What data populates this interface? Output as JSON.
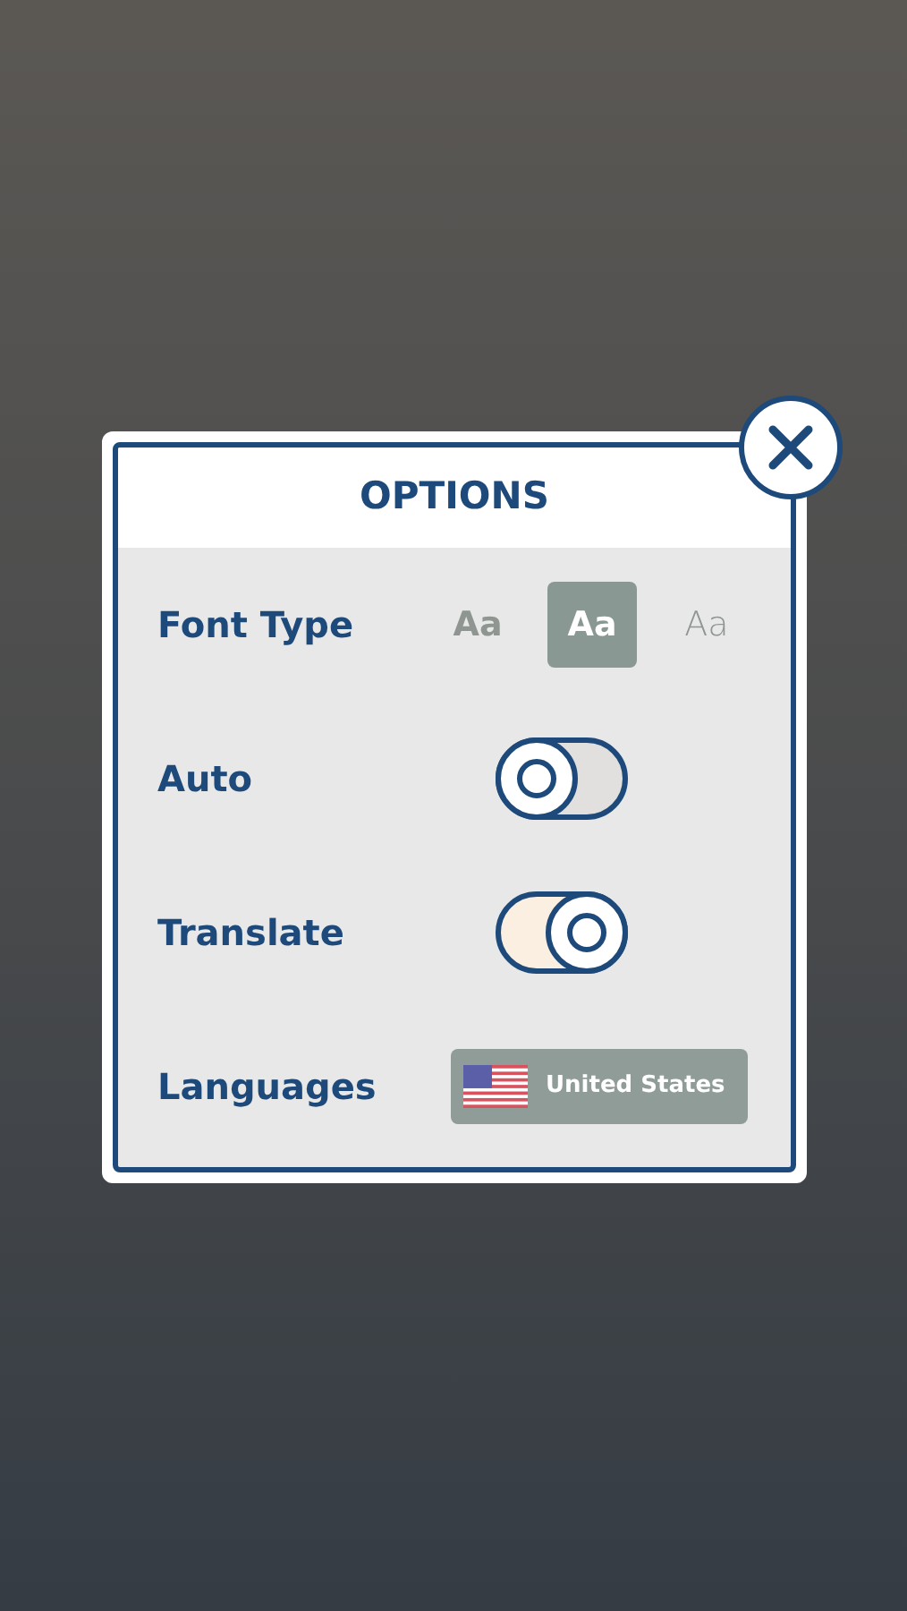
{
  "dialog": {
    "title": "OPTIONS",
    "font_type": {
      "label": "Font Type",
      "options": [
        {
          "label": "Aa",
          "kind": "bold",
          "selected": false
        },
        {
          "label": "Aa",
          "kind": "bold",
          "selected": true
        },
        {
          "label": "Aa",
          "kind": "light",
          "selected": false
        }
      ]
    },
    "toggles": [
      {
        "label": "Auto",
        "on": false
      },
      {
        "label": "Translate",
        "on": true
      }
    ],
    "languages": {
      "label": "Languages",
      "value": "United States"
    }
  }
}
